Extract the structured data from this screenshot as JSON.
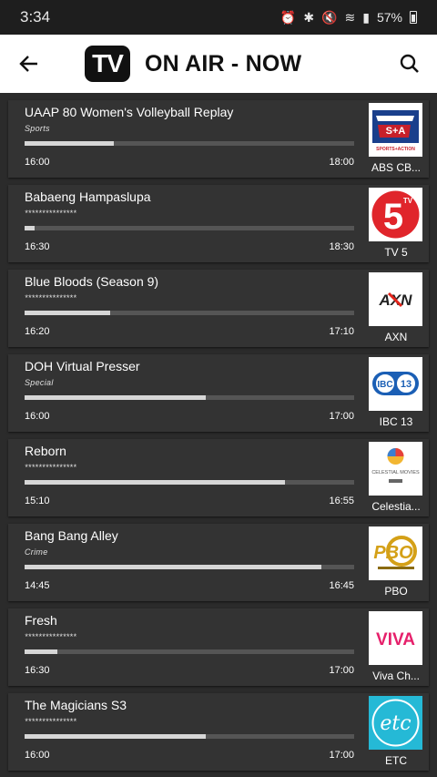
{
  "status": {
    "time": "3:34",
    "battery": "57%"
  },
  "header": {
    "logo_text": "TV",
    "title": "ON AIR - NOW"
  },
  "programs": [
    {
      "title": "UAAP 80 Women's Volleyball Replay",
      "genre": "Sports",
      "progress": 0.27,
      "start": "16:00",
      "end": "18:00",
      "channel": "ABS CB...",
      "logo": "abs-cbn-sports-action"
    },
    {
      "title": "Babaeng Hampaslupa",
      "genre": "***************",
      "progress": 0.03,
      "start": "16:30",
      "end": "18:30",
      "channel": "TV 5",
      "logo": "tv5"
    },
    {
      "title": "Blue Bloods (Season 9)",
      "genre": "***************",
      "progress": 0.26,
      "start": "16:20",
      "end": "17:10",
      "channel": "AXN",
      "logo": "axn"
    },
    {
      "title": "DOH Virtual Presser",
      "genre": "Special",
      "progress": 0.55,
      "start": "16:00",
      "end": "17:00",
      "channel": "IBC 13",
      "logo": "ibc13"
    },
    {
      "title": "Reborn",
      "genre": "***************",
      "progress": 0.79,
      "start": "15:10",
      "end": "16:55",
      "channel": "Celestia...",
      "logo": "celestial-movies"
    },
    {
      "title": "Bang Bang Alley",
      "genre": "Crime",
      "progress": 0.9,
      "start": "14:45",
      "end": "16:45",
      "channel": "PBO",
      "logo": "pbo"
    },
    {
      "title": "Fresh",
      "genre": "***************",
      "progress": 0.1,
      "start": "16:30",
      "end": "17:00",
      "channel": "Viva Ch...",
      "logo": "viva"
    },
    {
      "title": "The Magicians S3",
      "genre": "***************",
      "progress": 0.55,
      "start": "16:00",
      "end": "17:00",
      "channel": "ETC",
      "logo": "etc"
    }
  ],
  "logo_texts": {
    "abs": "SPORTS+ACTION",
    "tv5": "5",
    "tv5_small": "TV",
    "axn": "AXN",
    "ibc_left": "IBC",
    "ibc_right": "13",
    "celestial": "CELESTIAL MOVIES",
    "pbo": "PBO",
    "viva": "VIVA",
    "etc": "etc"
  },
  "colors": {
    "appbar": "#ffffff",
    "background": "#2b2b2b",
    "card": "#333333",
    "progress_fill": "#d6d6d6",
    "progress_track": "#555555",
    "tv5_red": "#e0252b",
    "viva_pink": "#e6206b",
    "etc_teal": "#25b9d6"
  }
}
